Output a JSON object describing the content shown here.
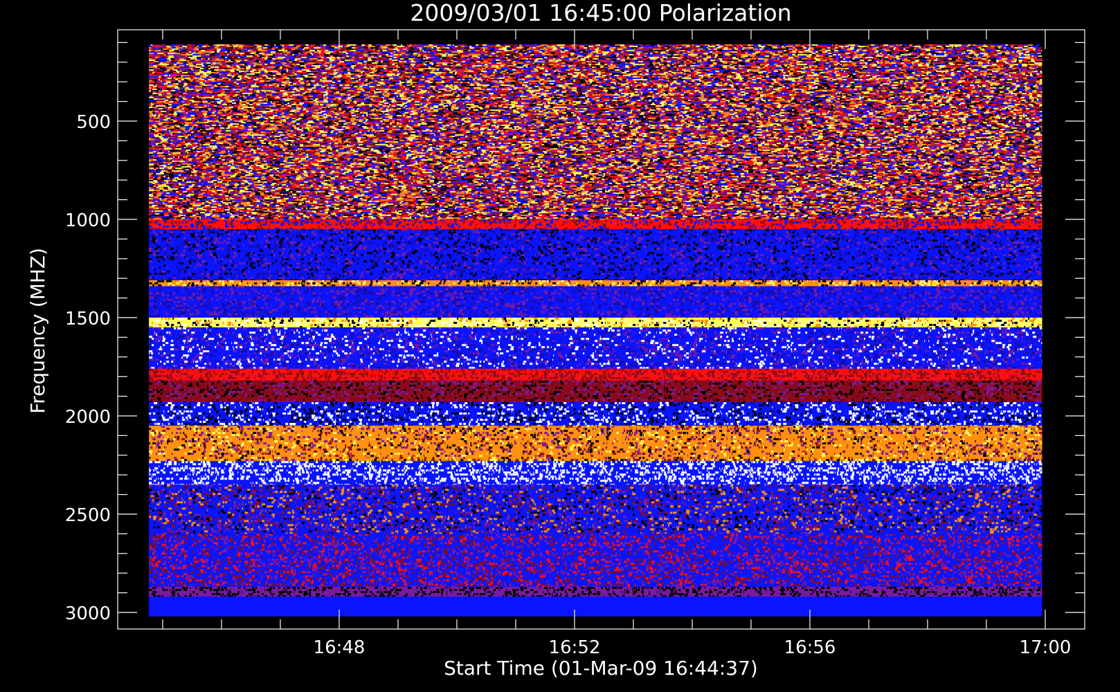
{
  "chart_data": {
    "type": "heatmap",
    "title": "2009/03/01 16:45:00 Polarization",
    "xlabel": "Start Time (01-Mar-09 16:44:37)",
    "ylabel": "Frequency (MHZ)",
    "x_ticks": [
      {
        "label": "16:48",
        "minutes": 3.383
      },
      {
        "label": "16:52",
        "minutes": 7.383
      },
      {
        "label": "16:56",
        "minutes": 11.383
      },
      {
        "label": "17:00",
        "minutes": 15.383
      }
    ],
    "y_ticks": [
      500,
      1000,
      1500,
      2000,
      2500,
      3000
    ],
    "ylim": [
      35,
      3085
    ],
    "y_inverted": true,
    "data_extent": {
      "time_minutes": [
        0.15,
        15.33
      ],
      "frequency_mhz": [
        110,
        3020
      ]
    },
    "colors": {
      "background": "#000000",
      "axis": "#ffffff",
      "blue": "#0a14ff",
      "dark_blue": "#1a0a9a",
      "purple": "#7a1aa0",
      "dark_red": "#8a0a1a",
      "red": "#ff1010",
      "orange": "#ff9010",
      "yellow": "#ffff60",
      "white": "#ffffff",
      "black": "#000000"
    },
    "frequency_bands": [
      {
        "range_mhz": [
          110,
          1000
        ],
        "pattern": "noise",
        "palette": [
          "purple",
          "blue",
          "dark_red",
          "orange",
          "yellow",
          "red",
          "black"
        ]
      },
      {
        "range_mhz": [
          1000,
          1050
        ],
        "pattern": "stripe",
        "palette": [
          "red",
          "dark_red",
          "blue"
        ]
      },
      {
        "range_mhz": [
          1050,
          1310
        ],
        "pattern": "stripe",
        "palette": [
          "blue",
          "dark_blue",
          "purple",
          "black"
        ]
      },
      {
        "range_mhz": [
          1310,
          1340
        ],
        "pattern": "stripe",
        "palette": [
          "orange",
          "yellow",
          "black"
        ]
      },
      {
        "range_mhz": [
          1340,
          1500
        ],
        "pattern": "stripe",
        "palette": [
          "blue",
          "dark_blue",
          "purple"
        ]
      },
      {
        "range_mhz": [
          1500,
          1550
        ],
        "pattern": "stripe",
        "palette": [
          "yellow",
          "white",
          "black",
          "orange"
        ]
      },
      {
        "range_mhz": [
          1550,
          1760
        ],
        "pattern": "stripe",
        "palette": [
          "blue",
          "dark_blue",
          "purple",
          "white"
        ]
      },
      {
        "range_mhz": [
          1760,
          1820
        ],
        "pattern": "stripe",
        "palette": [
          "red",
          "dark_red"
        ]
      },
      {
        "range_mhz": [
          1820,
          1930
        ],
        "pattern": "stripe",
        "palette": [
          "dark_red",
          "black",
          "purple"
        ]
      },
      {
        "range_mhz": [
          1930,
          2050
        ],
        "pattern": "stripe",
        "palette": [
          "blue",
          "white",
          "black"
        ]
      },
      {
        "range_mhz": [
          2050,
          2230
        ],
        "pattern": "stripe",
        "palette": [
          "orange",
          "dark_red",
          "yellow",
          "black",
          "purple"
        ]
      },
      {
        "range_mhz": [
          2230,
          2350
        ],
        "pattern": "stripe",
        "palette": [
          "blue",
          "white"
        ]
      },
      {
        "range_mhz": [
          2350,
          2600
        ],
        "pattern": "stripe",
        "palette": [
          "blue",
          "purple",
          "dark_red",
          "orange",
          "black"
        ]
      },
      {
        "range_mhz": [
          2600,
          2870
        ],
        "pattern": "stripe",
        "palette": [
          "blue",
          "dark_red",
          "purple",
          "red"
        ]
      },
      {
        "range_mhz": [
          2870,
          2920
        ],
        "pattern": "stripe",
        "palette": [
          "purple",
          "black"
        ]
      },
      {
        "range_mhz": [
          2920,
          3020
        ],
        "pattern": "stripe",
        "palette": [
          "blue"
        ]
      }
    ],
    "grid": false,
    "legend": "none"
  }
}
